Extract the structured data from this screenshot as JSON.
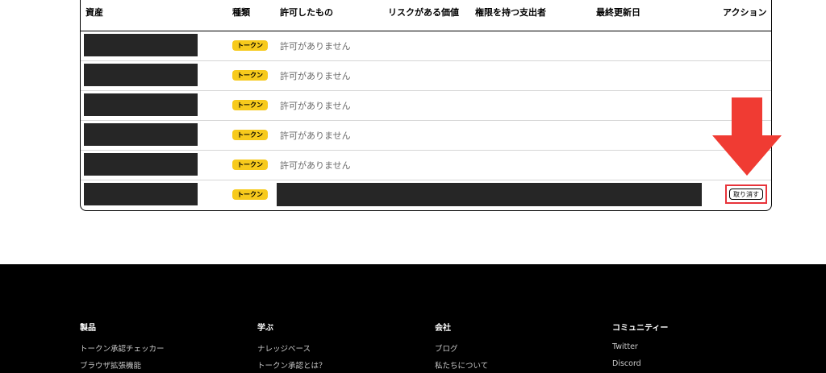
{
  "table": {
    "headers": {
      "asset": "資産",
      "type": "種類",
      "allowed": "許可したもの",
      "value_at_risk": "リスクがある価値",
      "spender": "権限を持つ支出者",
      "last_updated": "最終更新日",
      "action": "アクション"
    },
    "rows": [
      {
        "type_badge": "トークン",
        "allowed": "許可がありません"
      },
      {
        "type_badge": "トークン",
        "allowed": "許可がありません"
      },
      {
        "type_badge": "トークン",
        "allowed": "許可がありません"
      },
      {
        "type_badge": "トークン",
        "allowed": "許可がありません"
      },
      {
        "type_badge": "トークン",
        "allowed": "許可がありません"
      },
      {
        "type_badge": "トークン",
        "allowed": "",
        "action_label": "取り消す"
      }
    ]
  },
  "annotation": {
    "color": "#f03b33"
  },
  "footer": {
    "columns": [
      {
        "heading": "製品",
        "links": [
          "トークン承認チェッカー",
          "ブラウザ拡張機能"
        ]
      },
      {
        "heading": "学ぶ",
        "links": [
          "ナレッジベース",
          "トークン承認とは？"
        ]
      },
      {
        "heading": "会社",
        "links": [
          "ブログ",
          "私たちについて"
        ]
      },
      {
        "heading": "コミュニティー",
        "links": [
          "Twitter",
          "Discord"
        ]
      }
    ]
  },
  "colors": {
    "badge": "#f7ca1c",
    "redaction": "#262626",
    "highlight": "#e8333a",
    "footer_bg": "#000000"
  }
}
